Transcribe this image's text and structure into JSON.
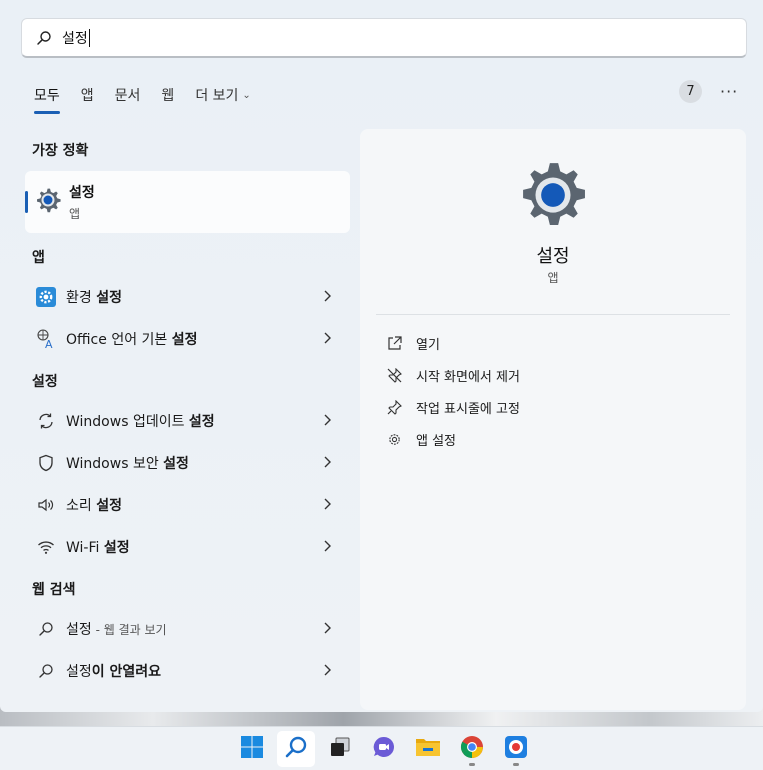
{
  "search": {
    "value": "설정"
  },
  "tabs": [
    {
      "label": "모두",
      "active": true
    },
    {
      "label": "앱"
    },
    {
      "label": "문서"
    },
    {
      "label": "웹"
    },
    {
      "label": "더 보기"
    }
  ],
  "badge_count": "7",
  "more_label": "···",
  "sections": {
    "best_match": "가장 정확",
    "apps": "앱",
    "settings": "설정",
    "web": "웹 검색"
  },
  "best_match": {
    "title": "설정",
    "subtitle": "앱",
    "icon": "settings-gear-icon"
  },
  "apps": [
    {
      "pre": "환경 ",
      "bold": "설정",
      "icon": "gear-blue-icon"
    },
    {
      "pre": "Office 언어 기본 ",
      "bold": "설정",
      "icon": "language-icon"
    }
  ],
  "settings": [
    {
      "pre": "Windows 업데이트 ",
      "bold": "설정",
      "icon": "refresh-icon"
    },
    {
      "pre": "Windows 보안 ",
      "bold": "설정",
      "icon": "shield-icon"
    },
    {
      "pre": "소리 ",
      "bold": "설정",
      "icon": "speaker-icon"
    },
    {
      "pre": "Wi-Fi ",
      "bold": "설정",
      "icon": "wifi-icon"
    }
  ],
  "web": [
    {
      "pre": "설정",
      "sub": " - 웹 결과 보기",
      "icon": "search-icon"
    },
    {
      "pre": "설정",
      "bold": "이 안열려요",
      "icon": "search-icon"
    }
  ],
  "detail": {
    "title": "설정",
    "subtitle": "앱",
    "actions": [
      {
        "label": "열기",
        "icon": "open-external-icon"
      },
      {
        "label": "시작 화면에서 제거",
        "icon": "unpin-icon"
      },
      {
        "label": "작업 표시줄에 고정",
        "icon": "pin-icon"
      },
      {
        "label": "앱 설정",
        "icon": "gear-icon"
      }
    ]
  },
  "colors": {
    "accent": "#1a5fb4",
    "panel": "#eef2f6"
  }
}
